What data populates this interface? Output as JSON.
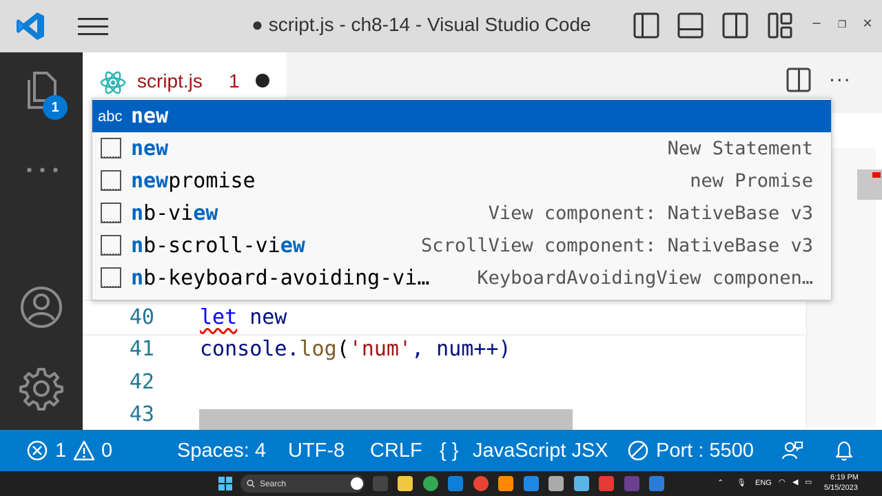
{
  "titlebar": {
    "title": "● script.js - ch8-14 - Visual Studio Code",
    "minimize": "─",
    "restore": "❐",
    "close": "✕"
  },
  "activity": {
    "explorer_badge": "1",
    "more": "•••"
  },
  "tab": {
    "label": "script.js",
    "problem_count": "1",
    "more": "···"
  },
  "editor": {
    "lines": [
      {
        "num": "40",
        "keyword": "let",
        "rest": " new"
      },
      {
        "num": "41",
        "fn_obj": "console.",
        "fn": "log",
        "open": "(",
        "str": "'num'",
        "rest": ", num++)"
      },
      {
        "num": "42"
      },
      {
        "num": "43"
      }
    ]
  },
  "suggest": {
    "selected": {
      "label": "new",
      "icon": "abc"
    },
    "items": [
      {
        "match": "new",
        "rest": "",
        "detail": "New Statement"
      },
      {
        "match": "new",
        "rest": "promise",
        "detail": "new Promise"
      },
      {
        "pre": "n",
        "mid": "b-vi",
        "match2": "ew",
        "detail": "View component: NativeBase v3"
      },
      {
        "pre": "n",
        "mid": "b-scroll-vi",
        "match2": "ew",
        "detail": "ScrollView component: NativeBase v3"
      },
      {
        "pre": "n",
        "mid": "b-keyboard-avoiding-vi…",
        "detail": "KeyboardAvoidingView componen…"
      }
    ]
  },
  "statusbar": {
    "errors": "1",
    "warnings": "0",
    "spaces": "Spaces: 4",
    "encoding": "UTF-8",
    "eol": "CRLF",
    "language": "JavaScript JSX",
    "port": "Port : 5500"
  },
  "taskbar": {
    "search": "Search",
    "lang": "ENG",
    "time": "6:19 PM",
    "date": "5/15/2023"
  },
  "colors": {
    "accent": "#007acc",
    "selection": "#0060c0",
    "error": "#e51400"
  }
}
